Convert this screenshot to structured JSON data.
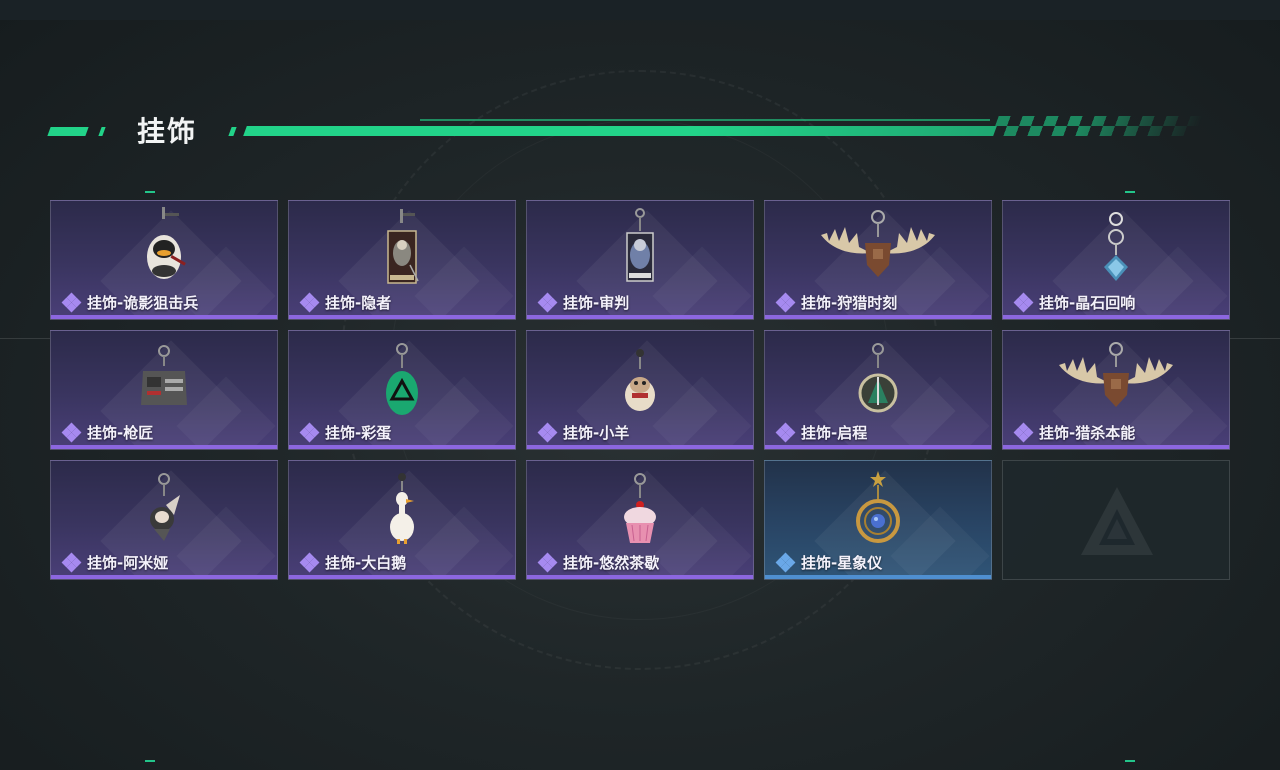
{
  "section": {
    "title": "挂饰"
  },
  "items": [
    {
      "name": "挂饰-诡影狙击兵",
      "rarity": "purple",
      "icon": "sniper-duck-charm-icon"
    },
    {
      "name": "挂饰-隐者",
      "rarity": "purple",
      "icon": "hermit-card-charm-icon"
    },
    {
      "name": "挂饰-审判",
      "rarity": "purple",
      "icon": "judgement-card-charm-icon"
    },
    {
      "name": "挂饰-狩猎时刻",
      "rarity": "purple",
      "icon": "antler-charm-icon"
    },
    {
      "name": "挂饰-晶石回响",
      "rarity": "purple",
      "icon": "crystal-charm-icon"
    },
    {
      "name": "挂饰-枪匠",
      "rarity": "purple",
      "icon": "gunsmith-charm-icon"
    },
    {
      "name": "挂饰-彩蛋",
      "rarity": "purple",
      "icon": "green-egg-charm-icon"
    },
    {
      "name": "挂饰-小羊",
      "rarity": "purple",
      "icon": "lamb-charm-icon"
    },
    {
      "name": "挂饰-启程",
      "rarity": "purple",
      "icon": "departure-ring-charm-icon"
    },
    {
      "name": "挂饰-猎杀本能",
      "rarity": "purple",
      "icon": "antler-charm-icon"
    },
    {
      "name": "挂饰-阿米娅",
      "rarity": "purple",
      "icon": "amiya-charm-icon"
    },
    {
      "name": "挂饰-大白鹅",
      "rarity": "purple",
      "icon": "white-goose-charm-icon"
    },
    {
      "name": "挂饰-悠然茶歇",
      "rarity": "purple",
      "icon": "cupcake-charm-icon"
    },
    {
      "name": "挂饰-星象仪",
      "rarity": "blue",
      "icon": "astrolabe-charm-icon"
    }
  ],
  "empty_slot": {
    "icon": "game-logo-icon"
  },
  "colors": {
    "accent": "#22d389",
    "purple_rarity": "#8c67e0",
    "blue_rarity": "#4f8fd0"
  }
}
